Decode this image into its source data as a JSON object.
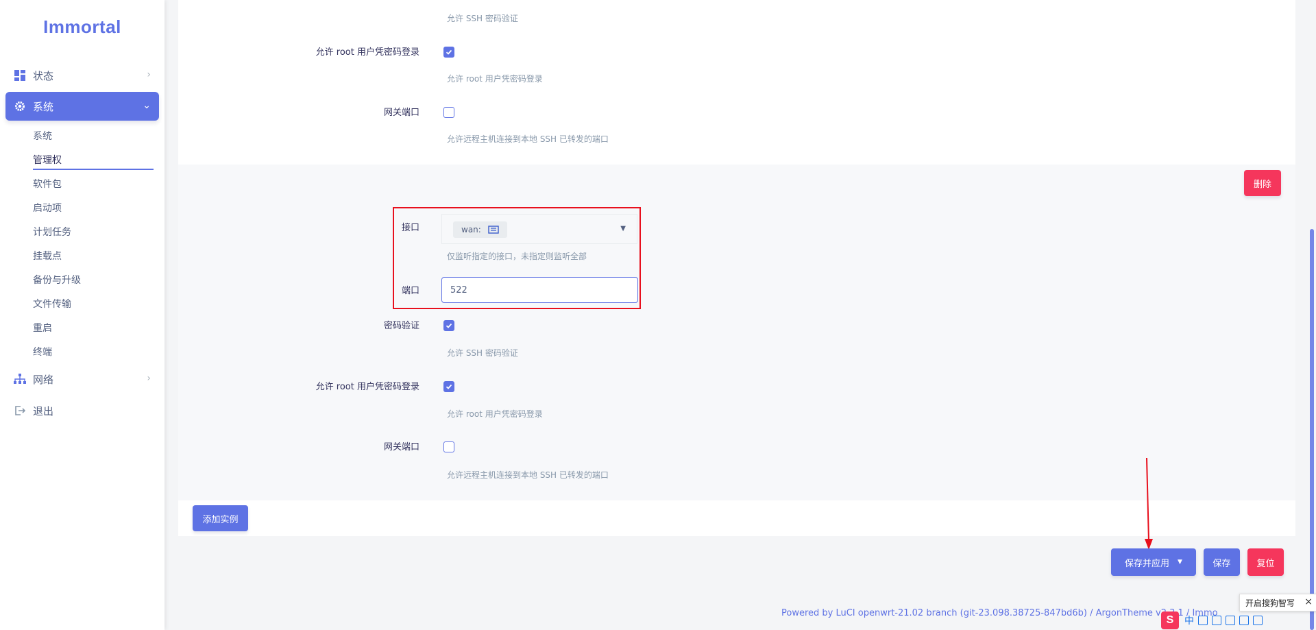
{
  "brand": {
    "name": "Immortal"
  },
  "nav": {
    "status": {
      "label": "状态",
      "icon": "dashboard-icon"
    },
    "system": {
      "label": "系统",
      "icon": "gear-icon"
    },
    "system_sub": [
      "系统",
      "管理权",
      "软件包",
      "启动项",
      "计划任务",
      "挂载点",
      "备份与升级",
      "文件传输",
      "重启",
      "终端"
    ],
    "current_sub": "管理权",
    "network": {
      "label": "网络",
      "icon": "sitemap-icon"
    },
    "logout": {
      "label": "退出",
      "icon": "sign-out-icon"
    }
  },
  "instance1": {
    "password_auth_hint": "允许 SSH 密码验证",
    "root_login_label": "允许 root 用户凭密码登录",
    "root_login_checked": true,
    "root_login_hint": "允许 root 用户凭密码登录",
    "gateway_ports_label": "网关端口",
    "gateway_ports_checked": false,
    "gateway_ports_hint": "允许远程主机连接到本地 SSH 已转发的端口"
  },
  "instance2": {
    "delete_label": "删除",
    "interface_label": "接口",
    "interface_value": "wan:",
    "interface_hint": "仅监听指定的接口，未指定则监听全部",
    "port_label": "端口",
    "port_value": "522",
    "password_auth_label": "密码验证",
    "password_auth_checked": true,
    "password_auth_hint": "允许 SSH 密码验证",
    "root_login_label": "允许 root 用户凭密码登录",
    "root_login_checked": true,
    "root_login_hint": "允许 root 用户凭密码登录",
    "gateway_ports_label": "网关端口",
    "gateway_ports_checked": false,
    "gateway_ports_hint": "允许远程主机连接到本地 SSH 已转发的端口"
  },
  "actions": {
    "add_instance": "添加实例",
    "save_apply": "保存并应用",
    "save": "保存",
    "reset": "复位"
  },
  "footer": {
    "text": "Powered by LuCI openwrt-21.02 branch (git-23.098.38725-847bd6b) / ArgonTheme v2.3.1 / Immo"
  },
  "ime": {
    "tip": "开启搜狗智写",
    "logo": "S",
    "mode": "中"
  },
  "colors": {
    "accent": "#5e72e4",
    "danger": "#f5365c",
    "annotation": "#e8101d"
  }
}
